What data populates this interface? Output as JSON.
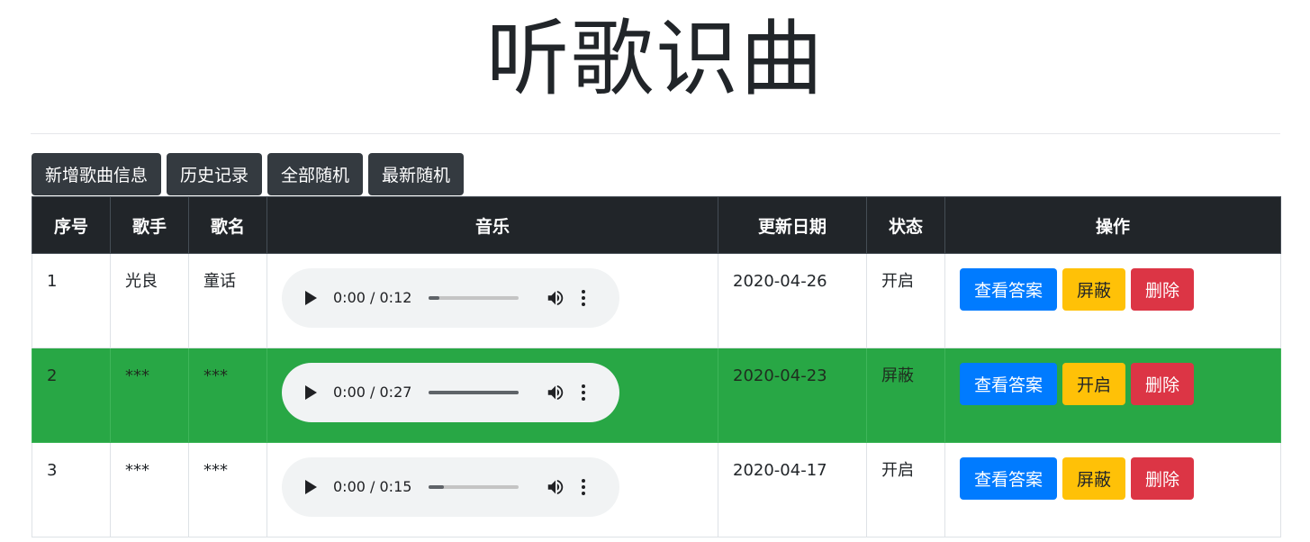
{
  "title": "听歌识曲",
  "toolbar": {
    "add_label": "新增歌曲信息",
    "history_label": "历史记录",
    "random_all_label": "全部随机",
    "random_latest_label": "最新随机"
  },
  "table": {
    "headers": [
      "序号",
      "歌手",
      "歌名",
      "音乐",
      "更新日期",
      "状态",
      "操作"
    ],
    "rows": [
      {
        "index": "1",
        "singer": "光良",
        "song": "童话",
        "time": "0:00 / 0:12",
        "progress": 0.12,
        "date": "2020-04-26",
        "status": "开启",
        "highlight": false,
        "actions": {
          "view": "查看答案",
          "toggle": "屏蔽",
          "delete": "删除"
        }
      },
      {
        "index": "2",
        "singer": "***",
        "song": "***",
        "time": "0:00 / 0:27",
        "progress": 1.0,
        "date": "2020-04-23",
        "status": "屏蔽",
        "highlight": true,
        "actions": {
          "view": "查看答案",
          "toggle": "开启",
          "delete": "删除"
        }
      },
      {
        "index": "3",
        "singer": "***",
        "song": "***",
        "time": "0:00 / 0:15",
        "progress": 0.17,
        "date": "2020-04-17",
        "status": "开启",
        "highlight": false,
        "actions": {
          "view": "查看答案",
          "toggle": "屏蔽",
          "delete": "删除"
        }
      }
    ]
  },
  "colors": {
    "highlight_row": "#28a745",
    "header_bg": "#212529",
    "primary": "#007bff",
    "warning": "#ffc107",
    "danger": "#dc3545",
    "dark_button": "#343a40"
  },
  "icons": {
    "play": "play-icon",
    "volume": "volume-icon",
    "menu": "more-vert-icon"
  }
}
